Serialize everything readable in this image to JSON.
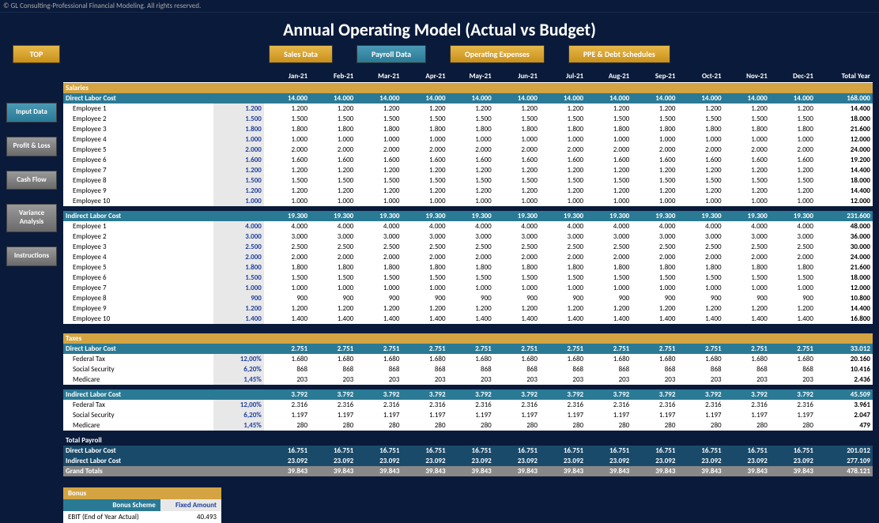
{
  "copyright": "© GL Consulting-Professional Financial Modeling. All rights reserved.",
  "title": "Annual Operating Model (Actual vs Budget)",
  "top_button": "TOP",
  "tabs": {
    "sales": "Sales Data",
    "payroll": "Payroll Data",
    "opex": "Operating Expenses",
    "ppe": "PPE & Debt Schedules"
  },
  "nav": {
    "input": "Input Data",
    "pl": "Profit & Loss",
    "cf": "Cash Flow",
    "var": "Variance Analysis",
    "inst": "Instructions"
  },
  "months": [
    "Jan-21",
    "Feb-21",
    "Mar-21",
    "Apr-21",
    "May-21",
    "Jun-21",
    "Jul-21",
    "Aug-21",
    "Sep-21",
    "Oct-21",
    "Nov-21",
    "Dec-21"
  ],
  "total_year_label": "Total Year",
  "salaries": {
    "header": "Salaries",
    "direct": {
      "label": "Direct Labor Cost",
      "month_val": "14.000",
      "total": "168.000",
      "rows": [
        {
          "label": "Employee 1",
          "input": "1.200",
          "v": "1.200",
          "t": "14.400"
        },
        {
          "label": "Employee 2",
          "input": "1.500",
          "v": "1.500",
          "t": "18.000"
        },
        {
          "label": "Employee 3",
          "input": "1.800",
          "v": "1.800",
          "t": "21.600"
        },
        {
          "label": "Employee 4",
          "input": "1.000",
          "v": "1.000",
          "t": "12.000"
        },
        {
          "label": "Employee 5",
          "input": "2.000",
          "v": "2.000",
          "t": "24.000"
        },
        {
          "label": "Employee 6",
          "input": "1.600",
          "v": "1.600",
          "t": "19.200"
        },
        {
          "label": "Employee 7",
          "input": "1.200",
          "v": "1.200",
          "t": "14.400"
        },
        {
          "label": "Employee 8",
          "input": "1.500",
          "v": "1.500",
          "t": "18.000"
        },
        {
          "label": "Employee 9",
          "input": "1.200",
          "v": "1.200",
          "t": "14.400"
        },
        {
          "label": "Employee 10",
          "input": "1.000",
          "v": "1.000",
          "t": "12.000"
        }
      ]
    },
    "indirect": {
      "label": "Indirect Labor Cost",
      "month_val": "19.300",
      "total": "231.600",
      "rows": [
        {
          "label": "Employee 1",
          "input": "4.000",
          "v": "4.000",
          "t": "48.000"
        },
        {
          "label": "Employee 2",
          "input": "3.000",
          "v": "3.000",
          "t": "36.000"
        },
        {
          "label": "Employee 3",
          "input": "2.500",
          "v": "2.500",
          "t": "30.000"
        },
        {
          "label": "Employee 4",
          "input": "2.000",
          "v": "2.000",
          "t": "24.000"
        },
        {
          "label": "Employee 5",
          "input": "1.800",
          "v": "1.800",
          "t": "21.600"
        },
        {
          "label": "Employee 6",
          "input": "1.500",
          "v": "1.500",
          "t": "18.000"
        },
        {
          "label": "Employee 7",
          "input": "1.000",
          "v": "1.000",
          "t": "12.000"
        },
        {
          "label": "Employee 8",
          "input": "900",
          "v": "900",
          "t": "10.800"
        },
        {
          "label": "Employee 9",
          "input": "1.200",
          "v": "1.200",
          "t": "14.400"
        },
        {
          "label": "Employee 10",
          "input": "1.400",
          "v": "1.400",
          "t": "16.800"
        }
      ]
    }
  },
  "taxes": {
    "header": "Taxes",
    "direct": {
      "label": "Direct Labor Cost",
      "month_val": "2.751",
      "total": "33.012",
      "rows": [
        {
          "label": "Federal Tax",
          "input": "12,00%",
          "v": "1.680",
          "t": "20.160"
        },
        {
          "label": "Social Security",
          "input": "6,20%",
          "v": "868",
          "t": "10.416"
        },
        {
          "label": "Medicare",
          "input": "1,45%",
          "v": "203",
          "t": "2.436"
        }
      ]
    },
    "indirect": {
      "label": "Indirect Labor Cost",
      "month_val": "3.792",
      "total": "45.509",
      "rows": [
        {
          "label": "Federal Tax",
          "input": "12,00%",
          "v": "2.316",
          "t": "3.961"
        },
        {
          "label": "Social Security",
          "input": "6,20%",
          "v": "1.197",
          "t": "2.047"
        },
        {
          "label": "Medicare",
          "input": "1,45%",
          "v": "280",
          "t": "479"
        }
      ]
    }
  },
  "total_payroll": {
    "header": "Total Payroll",
    "direct": {
      "label": "Direct Labor Cost",
      "v": "16.751",
      "t": "201.012"
    },
    "indirect": {
      "label": "Indirect Labor Cost",
      "v": "23.092",
      "t": "277.109"
    },
    "grand": {
      "label": "Grand Totals",
      "v": "39.843",
      "t": "478.121"
    }
  },
  "bonus": {
    "header": "Bonus",
    "scheme_label": "Bonus Scheme",
    "scheme_value": "Fixed Amount",
    "ebit_label": "EBIT (End of Year Actual)",
    "ebit_value": "40.493"
  }
}
